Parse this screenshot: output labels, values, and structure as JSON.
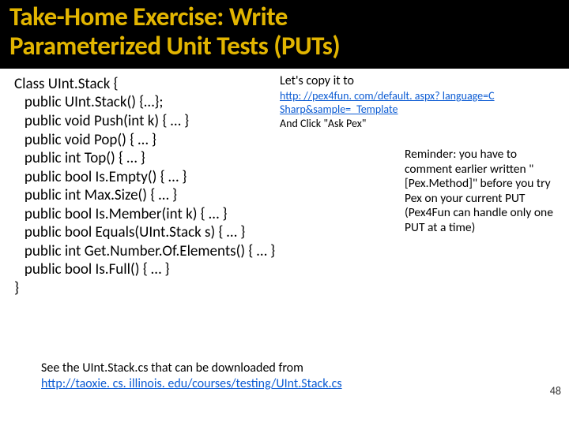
{
  "header": {
    "title_line1": "Take-Home Exercise: Write",
    "title_line2": "Parameterized Unit Tests (PUTs)"
  },
  "code": {
    "l1": "Class UInt.Stack {",
    "l2": "   public UInt.Stack() {…};",
    "l3": "   public void Push(int k) { … }",
    "l4": "   public void Pop() { … }",
    "l5": "   public int Top() { … }",
    "l6": "   public bool Is.Empty() { … }",
    "l7": "   public int Max.Size() { … }",
    "l8": "   public bool Is.Member(int k) { … }",
    "l9": "   public bool Equals(UInt.Stack s) { … }",
    "l10": "   public int Get.Number.Of.Elements() { … }",
    "l11": "   public bool Is.Full() { … }",
    "l12": "}"
  },
  "copy": {
    "lead": "Let's copy it to",
    "link_a": "http: //pex4fun. com/default. aspx? language=C",
    "link_b": "Sharp&sample=_Template",
    "after": "And Click \"Ask Pex\""
  },
  "reminder": {
    "text": "Reminder: you have to comment earlier written \"[Pex.Method]\" before you try Pex on your current PUT (Pex4Fun can handle only one PUT at a time)"
  },
  "footer": {
    "lead": "See the UInt.Stack.cs that can be downloaded from",
    "link": "http://taoxie. cs. illinois. edu/courses/testing/UInt.Stack.cs"
  },
  "page": {
    "number": "48"
  }
}
